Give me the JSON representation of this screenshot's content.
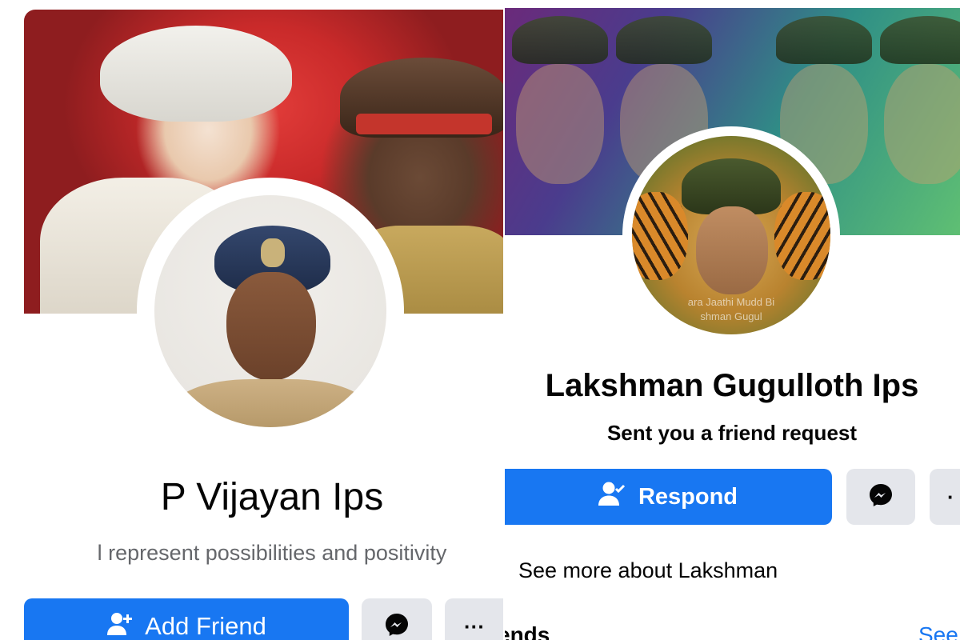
{
  "left_profile": {
    "name": "P Vijayan Ips",
    "bio": "l represent possibilities and positivity",
    "add_friend_label": "Add Friend",
    "add_friend_icon": "person-add-icon",
    "messenger_icon": "messenger-icon",
    "more_label": "···"
  },
  "right_profile": {
    "name": "Lakshman Gugulloth Ips",
    "subtitle": "Sent you a friend request",
    "respond_label": "Respond",
    "respond_icon": "person-check-icon",
    "messenger_icon": "messenger-icon",
    "more_label": "·",
    "see_more": "See more about Lakshman",
    "friends_heading": "ends",
    "see_all_link": "See",
    "avatar_caption_line1": "ara Jaathi Mudd Bi",
    "avatar_caption_line2": "shman Gugul"
  },
  "colors": {
    "primary": "#1877f2",
    "secondary_button": "#e4e6eb",
    "text": "#050505",
    "muted_text": "#65676b"
  }
}
